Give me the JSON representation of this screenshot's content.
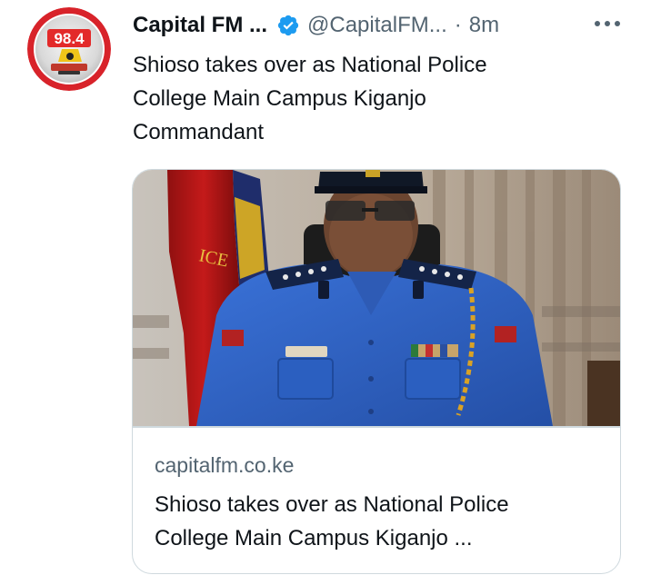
{
  "tweet": {
    "display_name": "Capital FM ...",
    "handle": "@CapitalFM...",
    "separator": "·",
    "time": "8m",
    "text_line1": "Shioso takes over as National Police",
    "text_line2": "College Main Campus Kiganjo",
    "text_line3": "Commandant",
    "avatar_logo_text": "98.4",
    "verified_color": "#1d9bf0",
    "more_icon": "more-horizontal-icon"
  },
  "card": {
    "domain": "capitalfm.co.ke",
    "title_line1": "Shioso takes over as National Police",
    "title_line2": "College Main Campus Kiganjo ...",
    "image_subject": "police-commandant-portrait"
  },
  "colors": {
    "text_primary": "#0f1419",
    "text_secondary": "#536471",
    "border": "#cfd9de",
    "uniform_blue": "#2f62c4",
    "brand_red": "#d8232a"
  }
}
